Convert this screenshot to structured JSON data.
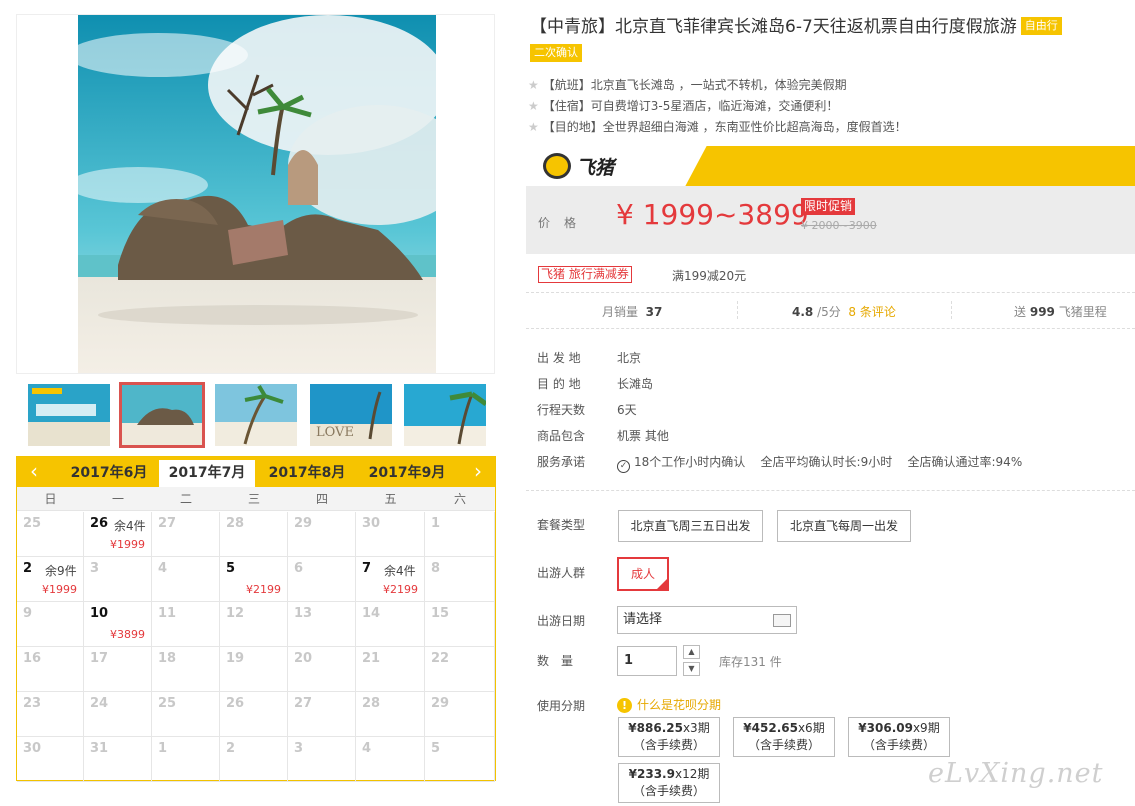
{
  "product": {
    "title": "【中青旅】北京直飞菲律宾长滩岛6-7天往返机票自由行度假旅游",
    "tag_type": "自由行",
    "tag_confirm": "二次确认",
    "features": [
      "【航班】北京直飞长滩岛 ，一站式不转机，体验完美假期",
      "【住宿】可自费增订3-5星酒店，临近海滩，交通便利！",
      "【目的地】全世界超细白海滩 ，东南亚性价比超高海岛，度假首选！"
    ]
  },
  "brand": {
    "name": "飞猪",
    "accent": "#f6c400"
  },
  "price": {
    "label": "价格",
    "current": "¥ 1999~3899",
    "promo": "限时促销",
    "original": "¥ 2000~3900",
    "color": "#e4393c"
  },
  "coupon": {
    "tag": "飞猪 旅行满减券",
    "text": "满199减20元"
  },
  "stats": {
    "sales_label": "月销量",
    "sales": "37",
    "rating": "4.8",
    "rating_unit": "/5分",
    "reviews": "8 条评论",
    "miles_prefix": "送",
    "miles": "999",
    "miles_suffix": "飞猪里程"
  },
  "details": [
    {
      "label": "出 发 地",
      "value": "北京"
    },
    {
      "label": "目 的 地",
      "value": "长滩岛"
    },
    {
      "label": "行程天数",
      "value": "6天"
    },
    {
      "label": "商品包含",
      "value": "机票  其他"
    }
  ],
  "service": {
    "label": "服务承诺",
    "items": [
      "18个工作小时内确认",
      "全店平均确认时长:9小时",
      "全店确认通过率:94%"
    ]
  },
  "options": {
    "package_label": "套餐类型",
    "packages": [
      "北京直飞周三五日出发",
      "北京直飞每周一出发"
    ],
    "group_label": "出游人群",
    "groups": [
      "成人"
    ],
    "date_label": "出游日期",
    "date_placeholder": "请选择",
    "qty_label": "数　量",
    "qty": "1",
    "stock": "库存131 件",
    "inst_label": "使用分期",
    "inst_help": "什么是花呗分期",
    "installments": [
      {
        "amt": "¥886.25",
        "per": "x3期",
        "note": "（含手续费）"
      },
      {
        "amt": "¥452.65",
        "per": "x6期",
        "note": "（含手续费）"
      },
      {
        "amt": "¥306.09",
        "per": "x9期",
        "note": "（含手续费）"
      },
      {
        "amt": "¥233.9",
        "per": "x12期",
        "note": "（含手续费）"
      }
    ]
  },
  "calendar": {
    "months": [
      "2017年6月",
      "2017年7月",
      "2017年8月",
      "2017年9月"
    ],
    "active_month": 1,
    "weekdays": [
      "日",
      "一",
      "二",
      "三",
      "四",
      "五",
      "六"
    ],
    "weeks": [
      [
        {
          "d": "25"
        },
        {
          "d": "26",
          "on": true,
          "stock": "余4件",
          "price": "¥1999"
        },
        {
          "d": "27"
        },
        {
          "d": "28"
        },
        {
          "d": "29"
        },
        {
          "d": "30"
        },
        {
          "d": "1"
        }
      ],
      [
        {
          "d": "2",
          "on": true,
          "stock": "余9件",
          "price": "¥1999"
        },
        {
          "d": "3"
        },
        {
          "d": "4"
        },
        {
          "d": "5",
          "on": true,
          "price": "¥2199"
        },
        {
          "d": "6"
        },
        {
          "d": "7",
          "on": true,
          "stock": "余4件",
          "price": "¥2199"
        },
        {
          "d": "8"
        }
      ],
      [
        {
          "d": "9"
        },
        {
          "d": "10",
          "on": true,
          "price": "¥3899"
        },
        {
          "d": "11"
        },
        {
          "d": "12"
        },
        {
          "d": "13"
        },
        {
          "d": "14"
        },
        {
          "d": "15"
        }
      ],
      [
        {
          "d": "16"
        },
        {
          "d": "17"
        },
        {
          "d": "18"
        },
        {
          "d": "19"
        },
        {
          "d": "20"
        },
        {
          "d": "21"
        },
        {
          "d": "22"
        }
      ],
      [
        {
          "d": "23"
        },
        {
          "d": "24"
        },
        {
          "d": "25"
        },
        {
          "d": "26"
        },
        {
          "d": "27"
        },
        {
          "d": "28"
        },
        {
          "d": "29"
        }
      ],
      [
        {
          "d": "30"
        },
        {
          "d": "31"
        },
        {
          "d": "1"
        },
        {
          "d": "2"
        },
        {
          "d": "3"
        },
        {
          "d": "4"
        },
        {
          "d": "5"
        }
      ]
    ]
  },
  "watermark": "eLvXing.net"
}
